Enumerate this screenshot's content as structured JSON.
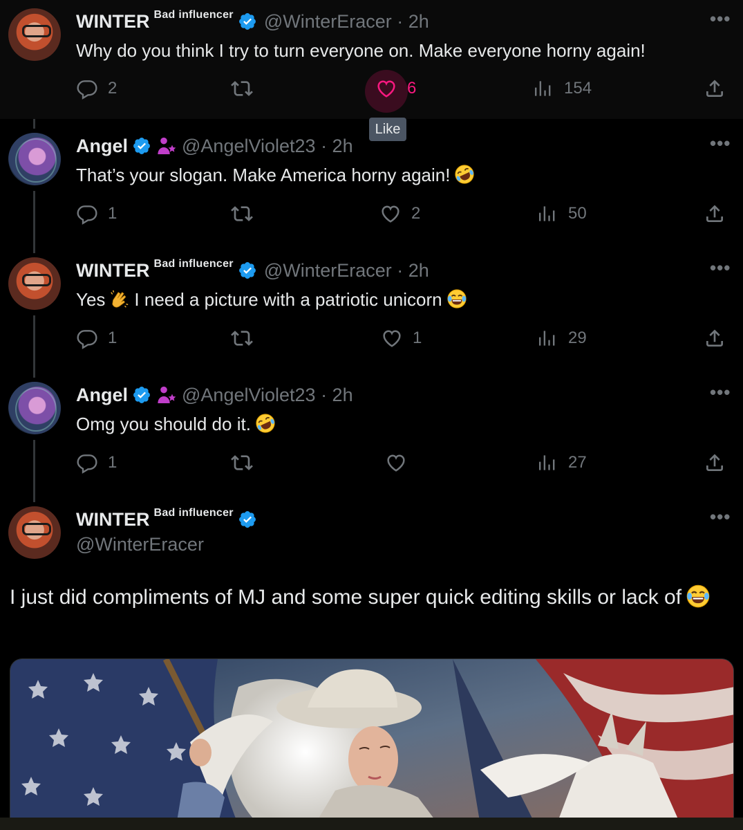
{
  "tooltip": "Like",
  "tweets": [
    {
      "name": "WINTER",
      "affiliation": "Bad influencer",
      "handle": "@WinterEracer · 2h",
      "text": "Why do you think I try to turn everyone on. Make everyone horny again!",
      "replies": "2",
      "retweets": "",
      "likes": "6",
      "views": "154",
      "liked": true
    },
    {
      "name": "Angel",
      "handle": "@AngelViolet23 · 2h",
      "text": "That’s your slogan. Make America horny again!",
      "emoji": "rolling-on-floor-laughing",
      "replies": "1",
      "retweets": "",
      "likes": "2",
      "views": "50"
    },
    {
      "name": "WINTER",
      "affiliation": "Bad influencer",
      "handle": "@WinterEracer · 2h",
      "text_before": "Yes",
      "text_after": "I need a picture with a patriotic unicorn",
      "emoji1": "clapping-hands",
      "emoji2": "tears-of-joy",
      "replies": "1",
      "retweets": "",
      "likes": "1",
      "views": "29"
    },
    {
      "name": "Angel",
      "handle": "@AngelViolet23 · 2h",
      "text": "Omg you should do it.",
      "emoji": "rolling-on-floor-laughing",
      "replies": "1",
      "retweets": "",
      "likes": "",
      "views": "27"
    }
  ],
  "main_tweet": {
    "name": "WINTER",
    "affiliation": "Bad influencer",
    "handle": "@WinterEracer",
    "text": "I just did compliments of MJ and some super quick editing skills or lack of",
    "emoji": "tears-of-joy",
    "media": "patriotic woman with white hair and tricorn hat holding flag beside white unicorn, American flags behind"
  },
  "colors": {
    "background": "#000000",
    "text": "#e7e9ea",
    "secondary": "#71767b",
    "like": "#f91880",
    "verified": "#1d9bf0"
  }
}
